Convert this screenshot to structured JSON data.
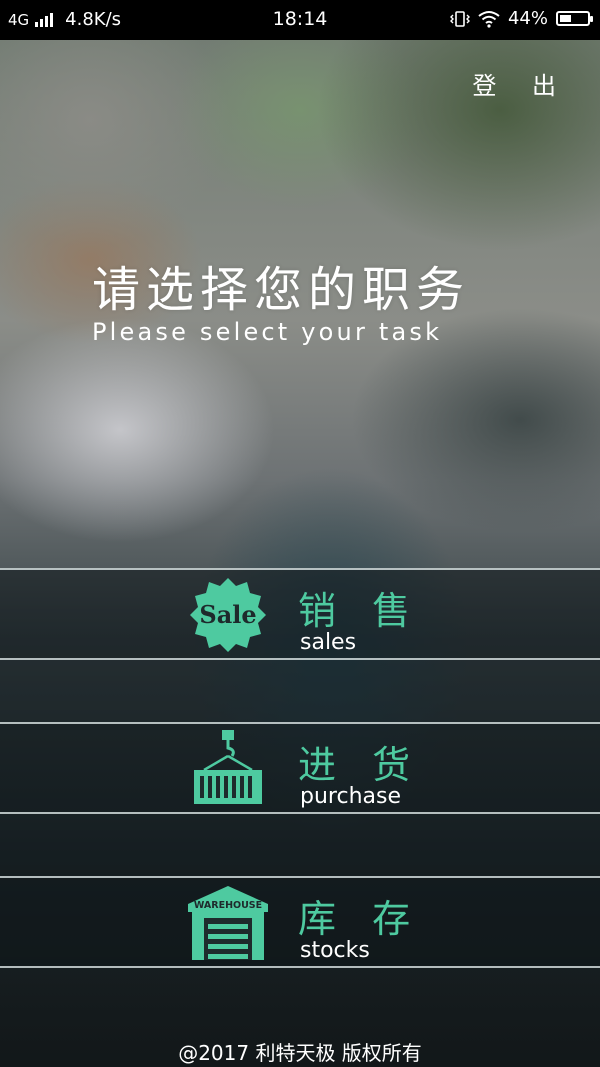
{
  "status_bar": {
    "network": "4G",
    "speed": "4.8K/s",
    "time": "18:14",
    "battery_percent": "44%",
    "battery_level": 0.44,
    "icons": [
      "signal-icon",
      "vibrate-icon",
      "wifi-icon",
      "battery-icon"
    ]
  },
  "header": {
    "logout_label": "登 出"
  },
  "main": {
    "title_cn": "请选择您的职务",
    "title_en": "Please select your task"
  },
  "tasks": [
    {
      "label_cn": "销 售",
      "label_en": "sales",
      "icon": "sale-badge-icon",
      "icon_text": "Sale"
    },
    {
      "label_cn": "进 货",
      "label_en": "purchase",
      "icon": "crane-container-icon"
    },
    {
      "label_cn": "库 存",
      "label_en": "stocks",
      "icon": "warehouse-icon",
      "icon_text": "WAREHOUSE"
    }
  ],
  "footer": {
    "copyright": "@2017 利特天极 版权所有"
  },
  "colors": {
    "accent": "#4ecaa0",
    "text": "#ffffff",
    "status_bar_bg": "#000000"
  }
}
